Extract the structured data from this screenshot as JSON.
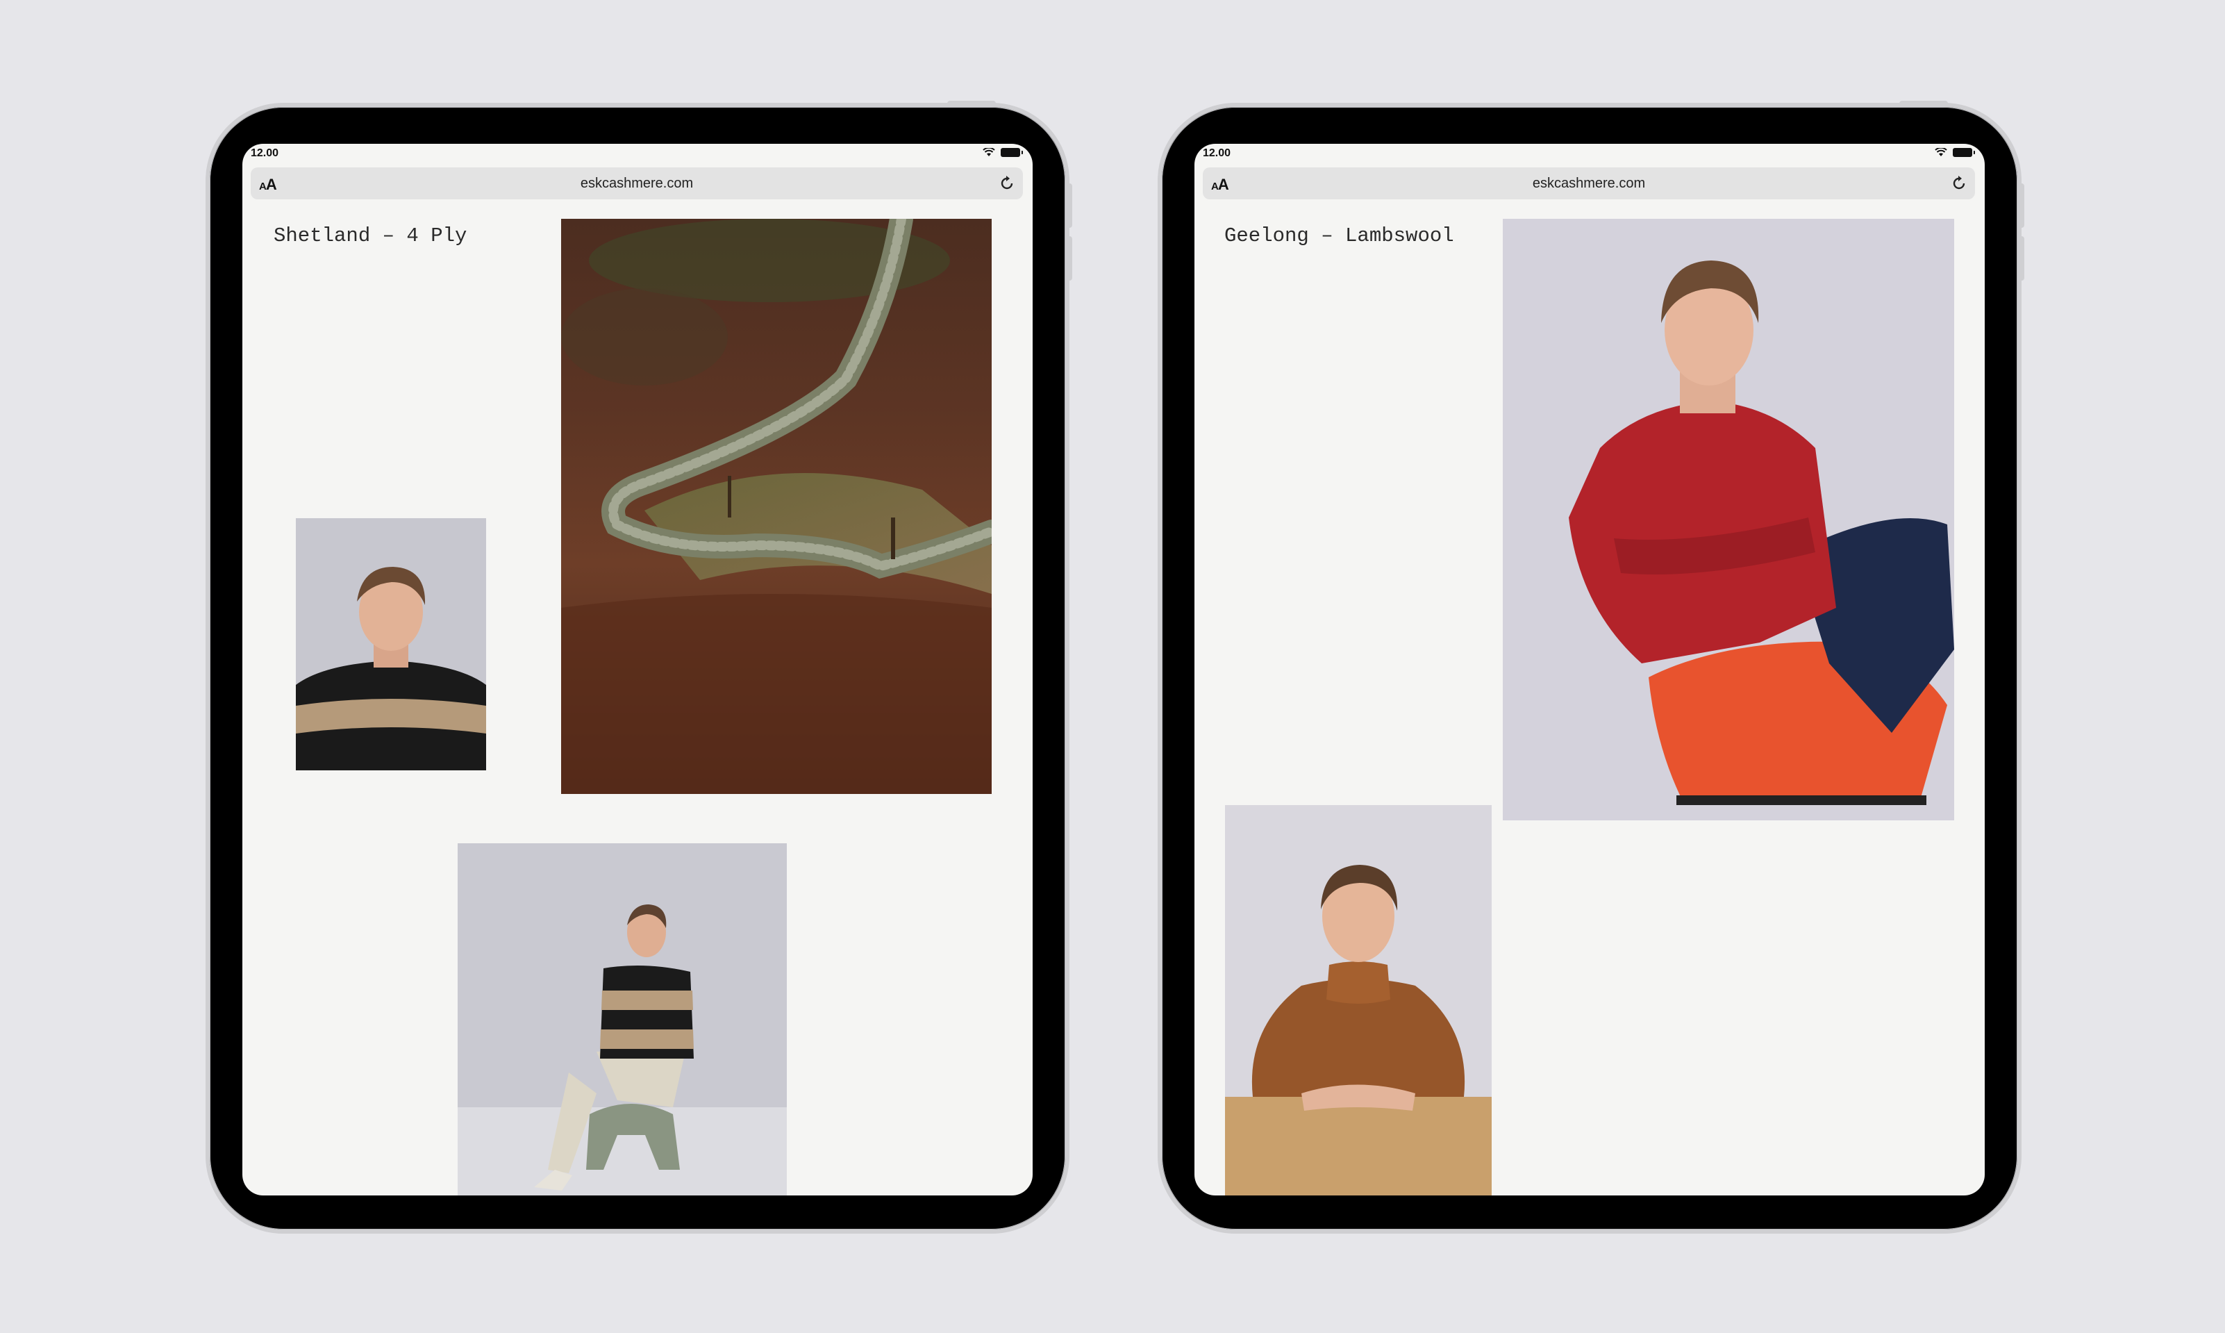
{
  "devices": [
    {
      "status_time": "12.00",
      "url": "eskcashmere.com",
      "text_size_label": "AA",
      "product_title": "Shetland – 4 Ply"
    },
    {
      "status_time": "12.00",
      "url": "eskcashmere.com",
      "text_size_label": "AA",
      "product_title": "Geelong – Lambswool"
    }
  ],
  "colors": {
    "page_background": "#e6e6ea",
    "screen_background": "#f5f5f3",
    "url_bar": "#e3e3e3",
    "device_frame": "#000000"
  },
  "icons": [
    "wifi-icon",
    "battery-icon",
    "reload-icon"
  ]
}
